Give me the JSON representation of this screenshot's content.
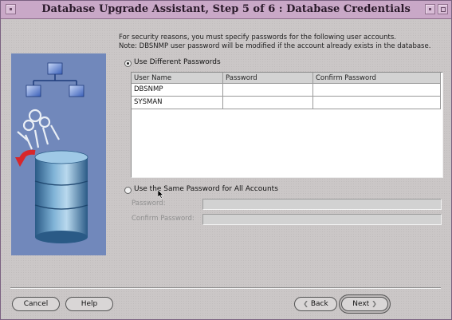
{
  "window": {
    "title": "Database Upgrade Assistant, Step 5 of 6 : Database Credentials"
  },
  "message": {
    "line1": "For security reasons, you must specify passwords for the following user accounts.",
    "line2": "Note: DBSNMP user password will be modified if the account already exists in the database."
  },
  "options": {
    "different_label": "Use Different Passwords",
    "same_label": "Use the Same Password for All Accounts",
    "selected": "different"
  },
  "table": {
    "columns": [
      "User Name",
      "Password",
      "Confirm Password"
    ],
    "rows": [
      {
        "user": "DBSNMP",
        "password": "",
        "confirm": ""
      },
      {
        "user": "SYSMAN",
        "password": "",
        "confirm": ""
      }
    ]
  },
  "same_password": {
    "password_label": "Password:",
    "confirm_label": "Confirm Password:",
    "password_value": "",
    "confirm_value": ""
  },
  "buttons": {
    "cancel": "Cancel",
    "help": "Help",
    "back": "Back",
    "next": "Next"
  },
  "colors": {
    "titlebar": "#c9a8c7",
    "dialog_bg": "#cbc7c7",
    "art_bg": "#7188bb"
  }
}
